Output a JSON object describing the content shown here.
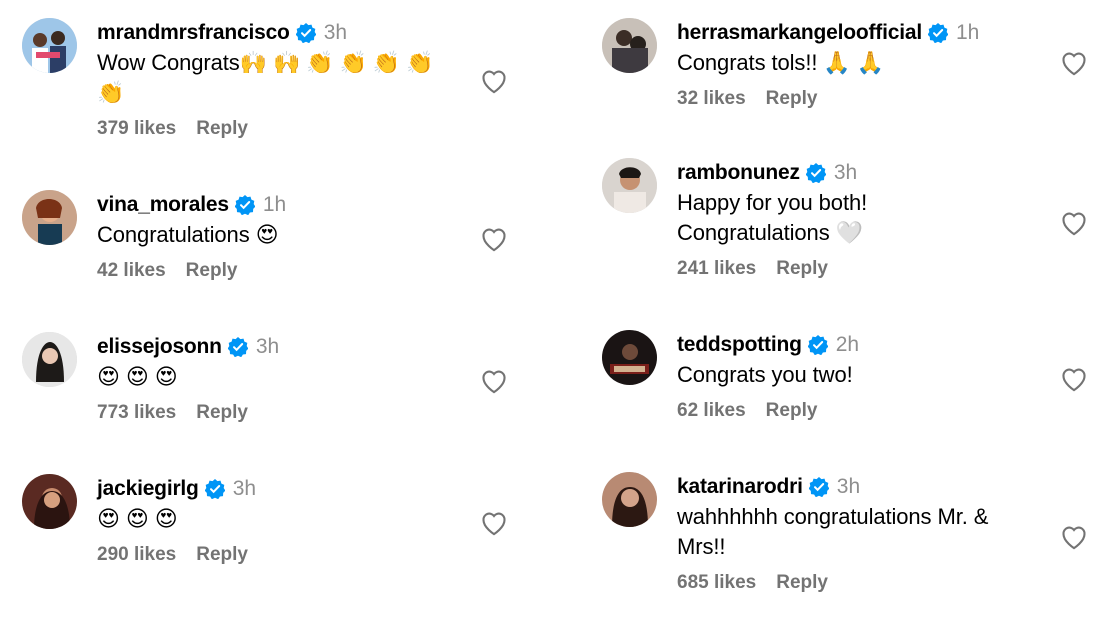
{
  "left": [
    {
      "username": "mrandmrsfrancisco",
      "time": "3h",
      "text": "Wow Congrats",
      "emojis": [
        "🙌",
        "🙌",
        "👏",
        "👏",
        "👏",
        "👏",
        "👏"
      ],
      "likes": "379 likes",
      "reply": "Reply"
    },
    {
      "username": "vina_morales",
      "time": "1h",
      "text": "Congratulations",
      "emojis": [
        "😍"
      ],
      "likes": "42 likes",
      "reply": "Reply"
    },
    {
      "username": "elissejosonn",
      "time": "3h",
      "text": "",
      "emojis": [
        "😍",
        "😍",
        "😍"
      ],
      "likes": "773 likes",
      "reply": "Reply"
    },
    {
      "username": "jackiegirlg",
      "time": "3h",
      "text": "",
      "emojis": [
        "😍",
        "😍",
        "😍"
      ],
      "likes": "290 likes",
      "reply": "Reply"
    }
  ],
  "right": [
    {
      "username": "herrasmarkangeloofficial",
      "time": "1h",
      "text": "Congrats tols!!",
      "emojis": [
        "🙏",
        "🙏"
      ],
      "likes": "32 likes",
      "reply": "Reply"
    },
    {
      "username": "rambonunez",
      "time": "3h",
      "text_line1": "Happy for you both!",
      "text_line2": "Congratulations",
      "emojis": [
        "🤍"
      ],
      "likes": "241 likes",
      "reply": "Reply"
    },
    {
      "username": "teddspotting",
      "time": "2h",
      "text": "Congrats you two!",
      "emojis": [],
      "likes": "62 likes",
      "reply": "Reply"
    },
    {
      "username": "katarinarodri",
      "time": "3h",
      "text_line1": "wahhhhhh congratulations Mr. &",
      "text_line2": "Mrs!!",
      "emojis": [],
      "likes": "685 likes",
      "reply": "Reply"
    }
  ],
  "colors": {
    "verified": "#0095f6",
    "muted": "#737373",
    "time": "#8e8e8e"
  },
  "icons": {
    "verified": "verified-badge-icon",
    "like": "heart-icon"
  }
}
